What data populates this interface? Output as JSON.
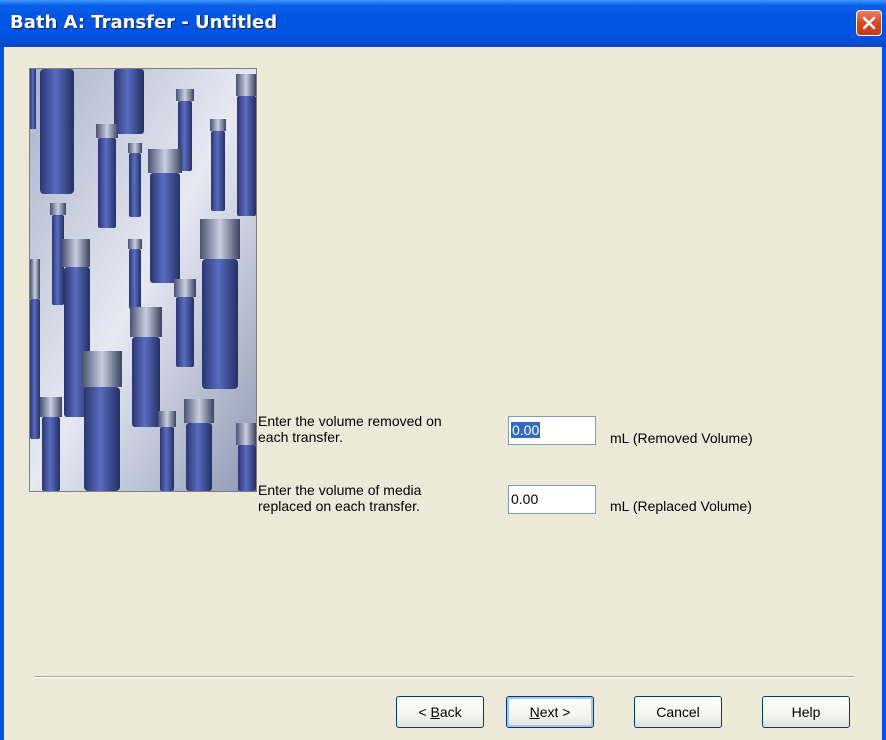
{
  "window": {
    "title": "Bath A: Transfer - Untitled"
  },
  "form": {
    "removed": {
      "label": "Enter the volume removed on\neach transfer.",
      "value": "0.00",
      "unit": "mL (Removed Volume)"
    },
    "replaced": {
      "label": "Enter the volume of media\nreplaced on each transfer.",
      "value": "0.00",
      "unit": "mL (Replaced Volume)"
    }
  },
  "buttons": {
    "back_prefix": "< ",
    "back_access": "B",
    "back_rest": "ack",
    "next_access": "N",
    "next_rest": "ext >",
    "cancel": "Cancel",
    "help": "Help"
  },
  "icons": {
    "close": "close-icon",
    "picture": "vials-illustration"
  },
  "colors": {
    "titlebar": "#0054e3",
    "dialog_bg": "#ece9d8",
    "selection": "#316ac5",
    "close_button": "#d9471f"
  }
}
